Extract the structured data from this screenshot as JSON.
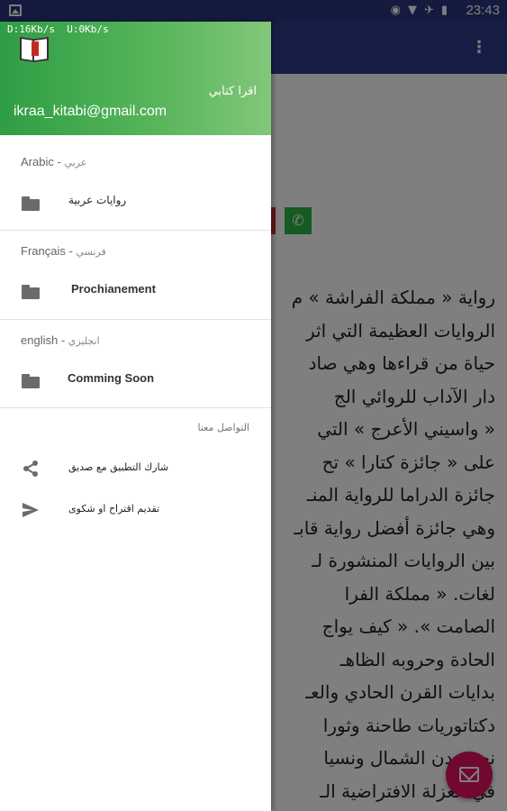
{
  "status_bar": {
    "time": "23:43",
    "icons": [
      "sync-icon",
      "wifi-icon",
      "airplane-icon",
      "battery-icon"
    ]
  },
  "net_speed": "D:16Kb/s  U:0Kb/s",
  "drawer": {
    "header": {
      "app_name": "اقرا كتابي",
      "email": "ikraa_kitabi@gmail.com",
      "gradient": [
        "#2f9d44",
        "#82c77a"
      ]
    },
    "sections": [
      {
        "title_latin": "Arabic",
        "title_native": "عربي",
        "item_label": "روايات عربية"
      },
      {
        "title_latin": "Français",
        "title_native": "فرنسي",
        "item_label": "Prochianement"
      },
      {
        "title_latin": "english",
        "title_native": "انجليزي",
        "item_label": "Comming Soon"
      }
    ],
    "contact": {
      "title": "التواصل معنا",
      "share_label": "شارك التطبيق مع صديق",
      "suggest_label": "تقديم اقتراح او شكوى"
    }
  },
  "article_lines": [
    "رواية « مملكة الفراشة » م",
    "الروايات العظيمة التي اثر",
    "حياة من قراءها وهي صاد",
    "دار الآداب للروائي الج",
    "« واسيني الأعرج » التي",
    "على « جائزة كتارا » تح",
    "جائزة الدراما للرواية المنـ",
    "وهي جائزة أفضل رواية قابـ",
    "بين الروايات المنشورة لـ",
    "لغات. « مملكة الفرا",
    "الصامت ». « كيف يواج",
    "الحادة وحروبه الظاهـ",
    "بدايات القرن الحادي والعـ",
    "دكتاتوريات طاحنة وثورا",
    "نحو مدن الشمال ونسيا",
    "في العزلة الافتراضية الـ"
  ],
  "colors": {
    "app_bar": "#2e3d8d",
    "status_bar": "#29377c",
    "fab": "#e3115e",
    "whatsapp": "#2db742"
  }
}
